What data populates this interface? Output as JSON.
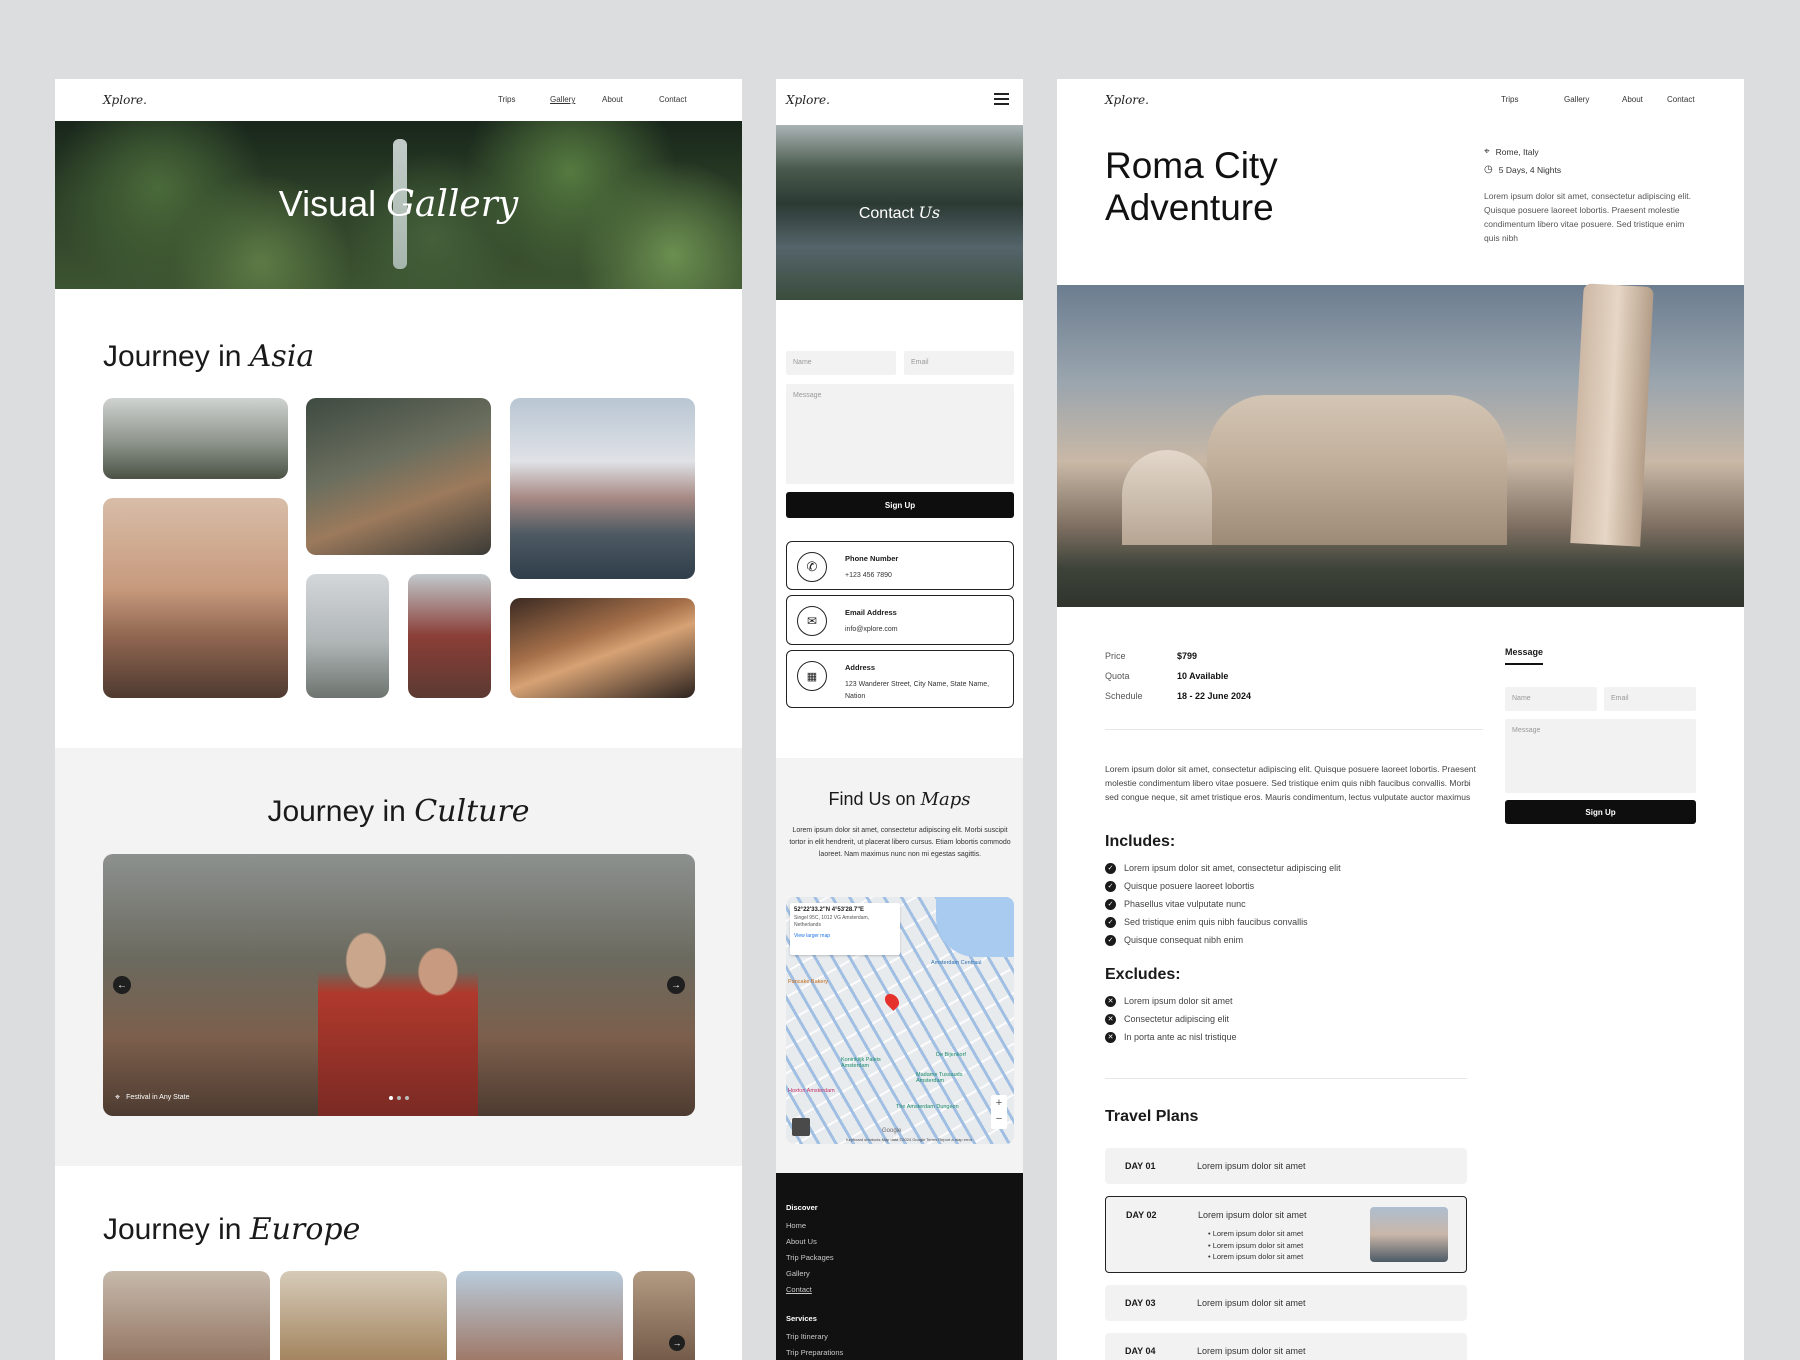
{
  "brand": "Xplore.",
  "nav": [
    "Trips",
    "Gallery",
    "About",
    "Contact"
  ],
  "gallery_page": {
    "hero_plain": "Visual",
    "hero_italic": "Gallery",
    "asia_plain": "Journey in",
    "asia_italic": "Asia",
    "culture_plain": "Journey in",
    "culture_italic": "Culture",
    "culture_caption": "Festival in Any State",
    "europe_plain": "Journey in",
    "europe_italic": "Europe"
  },
  "contact_page": {
    "hero_plain": "Contact",
    "hero_italic": "Us",
    "name_placeholder": "Name",
    "email_placeholder": "Email",
    "message_placeholder": "Message",
    "submit_label": "Sign Up",
    "cards": [
      {
        "title": "Phone Number",
        "value": "+123 456 7890"
      },
      {
        "title": "Email Address",
        "value": "info@xplore.com"
      },
      {
        "title": "Address",
        "value": "123 Wanderer Street, City Name, State Name, Nation"
      }
    ],
    "maps_plain": "Find Us on",
    "maps_italic": "Maps",
    "maps_text": "Lorem ipsum dolor sit amet, consectetur adipiscing elit. Morbi suscipit tortor in elit hendrerit, ut placerat libero cursus. Etiam lobortis commodo laoreet. Nam maximus nunc non mi egestas sagittis.",
    "map_coords": "52°22'33.2\"N 4°53'28.7\"E",
    "map_address": "Singel 95C, 1012 VG Amsterdam, Netherlands",
    "map_link": "View larger map",
    "map_labels": [
      "Amsterdam Centraal",
      "Madame Tussauds Amsterdam",
      "Koninklijk Paleis Amsterdam",
      "De Bijenkorf",
      "The Amsterdam Dungeon",
      "Pancake Bakery",
      "Hoxton Amsterdam",
      "Google"
    ],
    "map_footer": "Keyboard shortcuts   Map data ©2024 Google   Terms   Report a map error",
    "footer": {
      "discover_title": "Discover",
      "discover_links": [
        "Home",
        "About Us",
        "Trip Packages",
        "Gallery",
        "Contact"
      ],
      "services_title": "Services",
      "services_links": [
        "Trip Itinerary",
        "Trip Preparations"
      ]
    }
  },
  "trip_page": {
    "title_line1": "Roma City",
    "title_line2": "Adventure",
    "location": "Rome, Italy",
    "duration": "5 Days, 4 Nights",
    "summary": "Lorem ipsum dolor sit amet, consectetur adipiscing elit. Quisque posuere laoreet lobortis. Praesent molestie condimentum libero vitae posuere. Sed tristique enim quis nibh",
    "price_label": "Price",
    "price_value": "$799",
    "quota_label": "Quota",
    "quota_value": "10 Available",
    "schedule_label": "Schedule",
    "schedule_value": "18 - 22 June 2024",
    "description": "Lorem ipsum dolor sit amet, consectetur adipiscing elit. Quisque posuere laoreet lobortis. Praesent molestie condimentum libero vitae posuere. Sed tristique enim quis nibh faucibus convallis. Morbi sed congue neque, sit amet tristique eros. Mauris condimentum, lectus vulputate auctor maximus",
    "includes_title": "Includes:",
    "includes": [
      "Lorem ipsum dolor sit amet, consectetur adipiscing elit",
      "Quisque posuere laoreet lobortis",
      "Phasellus vitae vulputate nunc",
      "Sed tristique enim quis nibh faucibus convallis",
      "Quisque consequat nibh enim"
    ],
    "excludes_title": "Excludes:",
    "excludes": [
      "Lorem ipsum dolor sit amet",
      "Consectetur adipiscing elit",
      "In porta ante ac nisl tristique"
    ],
    "plans_title": "Travel Plans",
    "days": [
      {
        "day": "DAY 01",
        "text": "Lorem ipsum dolor sit amet"
      },
      {
        "day": "DAY 02",
        "text": "Lorem ipsum dolor sit amet",
        "bullets": [
          "Lorem ipsum dolor sit amet",
          "Lorem ipsum dolor sit amet",
          "Lorem ipsum dolor sit amet"
        ]
      },
      {
        "day": "DAY 03",
        "text": "Lorem ipsum dolor sit amet"
      },
      {
        "day": "DAY 04",
        "text": "Lorem ipsum dolor sit amet"
      }
    ],
    "message_tab": "Message",
    "name_placeholder": "Name",
    "email_placeholder": "Email",
    "message_placeholder": "Message",
    "submit_label": "Sign Up"
  }
}
